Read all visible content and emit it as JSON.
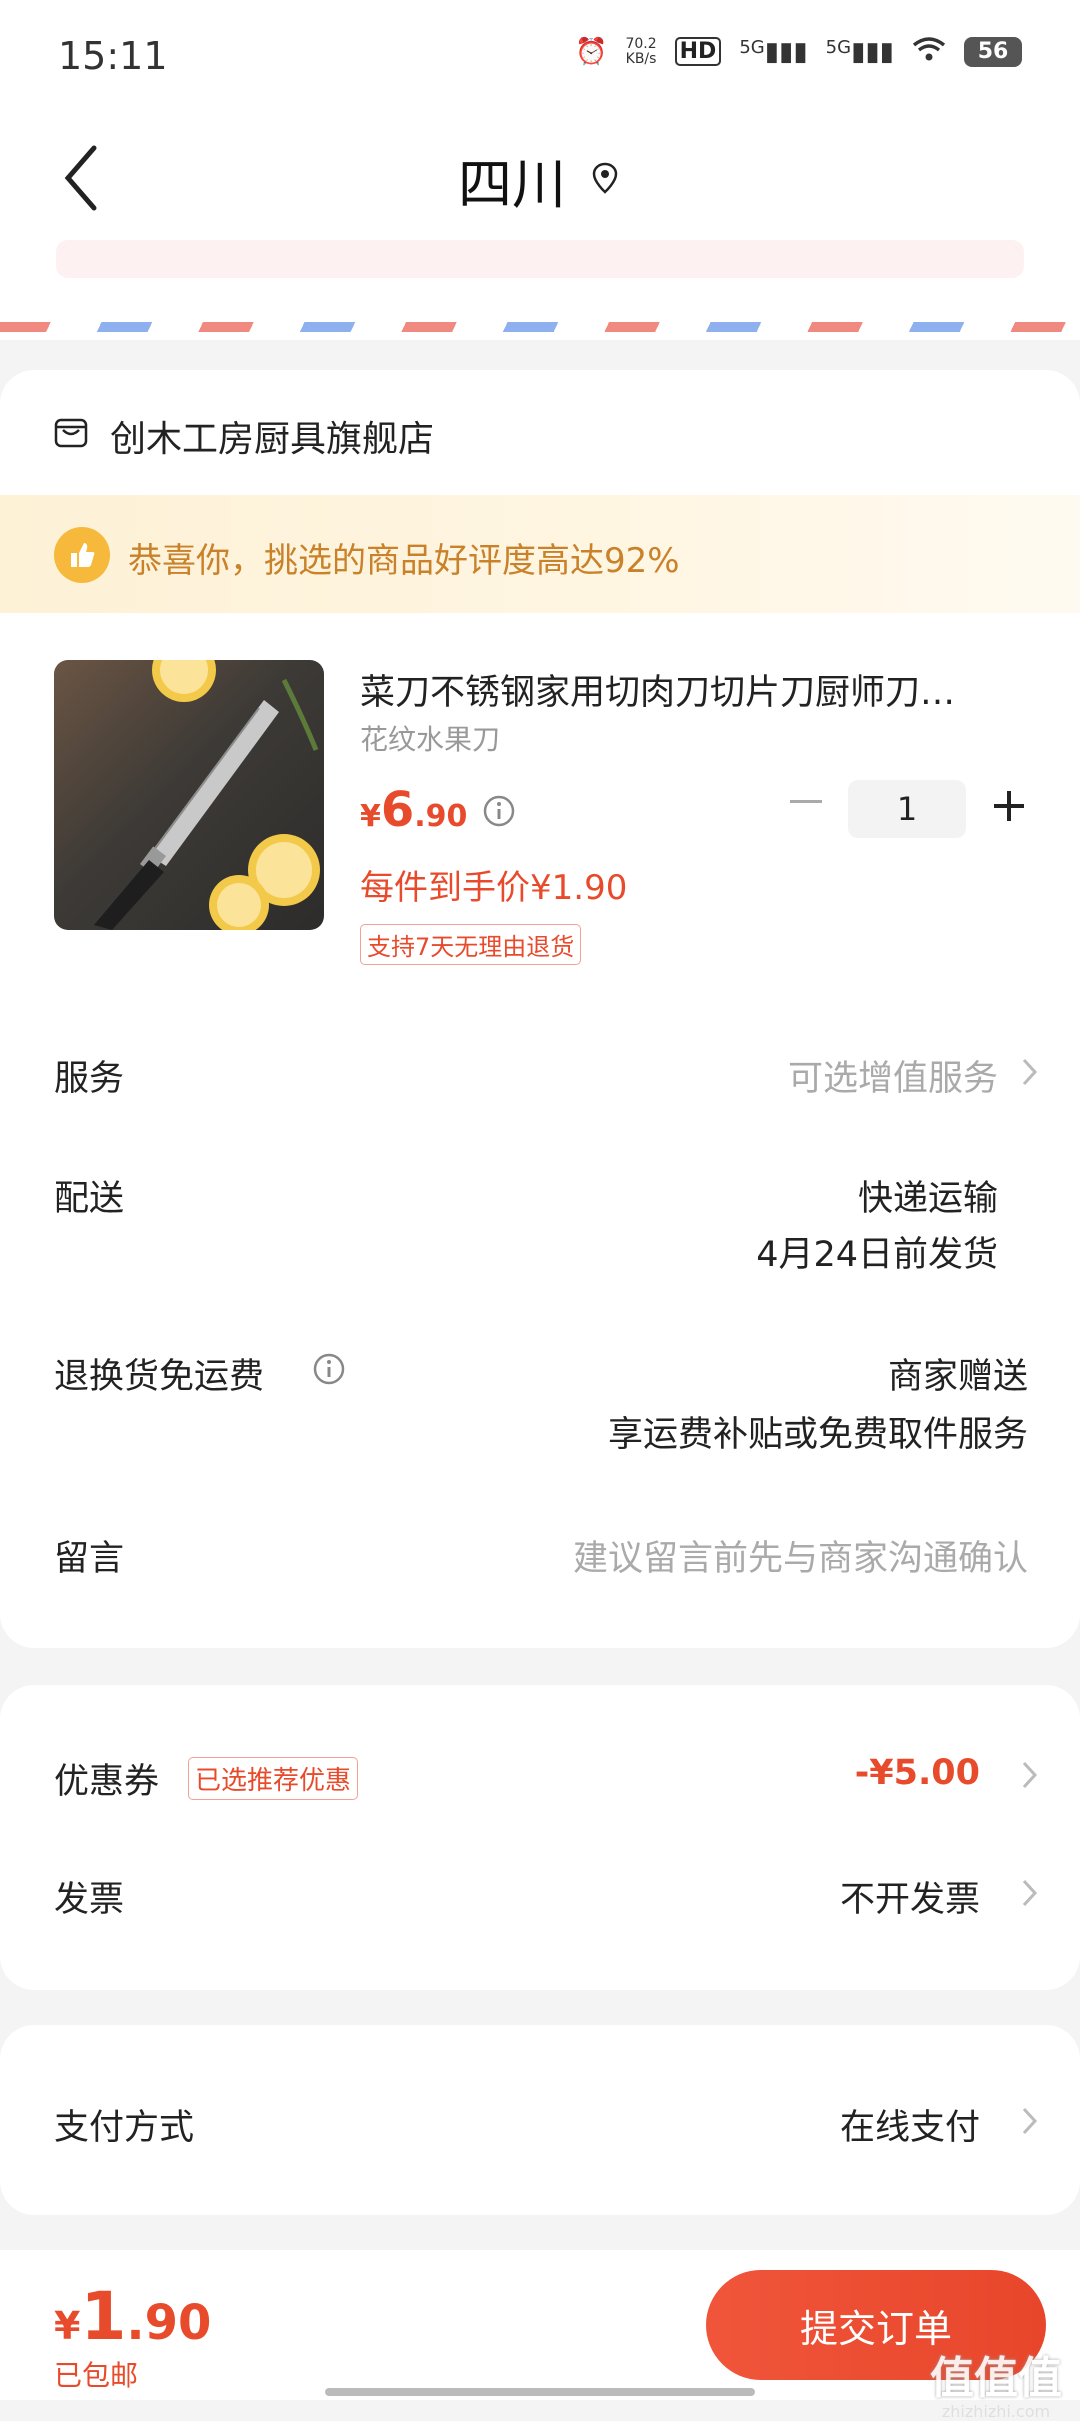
{
  "status_bar": {
    "time": "15:11",
    "net_speed": "70.2",
    "net_unit": "KB/s",
    "hd": "HD",
    "sig1": "5G",
    "sig2": "5G",
    "battery": "56"
  },
  "header": {
    "title": "四川"
  },
  "shop": {
    "name": "创木工房厨具旗舰店",
    "banner": "恭喜你，挑选的商品好评度高达92%"
  },
  "product": {
    "title": "菜刀不锈钢家用切肉刀切片刀厨师刀…",
    "spec": "花纹水果刀",
    "price_currency": "¥",
    "price_int": "6",
    "price_dec": ".90",
    "quantity": "1",
    "unit_price": "每件到手价¥1.90",
    "return_tag": "支持7天无理由退货"
  },
  "rows": {
    "service_label": "服务",
    "service_value": "可选增值服务",
    "delivery_label": "配送",
    "delivery_method": "快递运输",
    "delivery_date": "4月24日前发货",
    "return_label": "退换货免运费",
    "return_value": "商家赠送",
    "return_sub": "享运费补贴或免费取件服务",
    "message_label": "留言",
    "message_placeholder": "建议留言前先与商家沟通确认"
  },
  "discounts": {
    "coupon_label": "优惠券",
    "coupon_tag": "已选推荐优惠",
    "coupon_value": "-¥5.00",
    "invoice_label": "发票",
    "invoice_value": "不开发票"
  },
  "payment": {
    "label": "支付方式",
    "value": "在线支付"
  },
  "footer": {
    "currency": "¥",
    "total_int": "1",
    "total_dec": ".90",
    "ship_note": "已包邮",
    "submit": "提交订单"
  },
  "watermark": {
    "main": "值值值",
    "sub": "zhizhizhi.com"
  },
  "colors": {
    "accent": "#e84b2c",
    "banner_text": "#c9822a",
    "background": "#f4f4f4"
  }
}
